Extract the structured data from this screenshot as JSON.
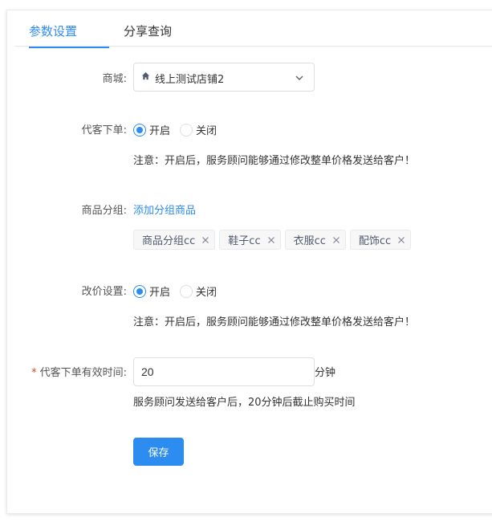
{
  "tabs": [
    {
      "label": "参数设置",
      "active": true
    },
    {
      "label": "分享查询",
      "active": false
    }
  ],
  "form": {
    "mall": {
      "label": "商城:",
      "value": "线上测试店铺2",
      "icon": "home-icon"
    },
    "proxy_order": {
      "label": "代客下单:",
      "options": [
        "开启",
        "关闭"
      ],
      "selected": "开启",
      "note": "注意：开启后，服务顾问能够通过修改整单价格发送给客户！"
    },
    "product_group": {
      "label": "商品分组:",
      "add_link": "添加分组商品",
      "tags": [
        "商品分组cc",
        "鞋子cc",
        "衣服cc",
        "配饰cc"
      ]
    },
    "price_edit": {
      "label": "改价设置:",
      "options": [
        "开启",
        "关闭"
      ],
      "selected": "开启",
      "note": "注意：开启后，服务顾问能够通过修改整单价格发送给客户！"
    },
    "valid_time": {
      "required_mark": "*",
      "label": "代客下单有效时间:",
      "value": "20",
      "unit": "分钟",
      "hint": "服务顾问发送给客户后，20分钟后截止购买时间"
    },
    "save_label": "保存"
  },
  "colors": {
    "primary": "#2d8cf0",
    "required": "#ed4014"
  }
}
